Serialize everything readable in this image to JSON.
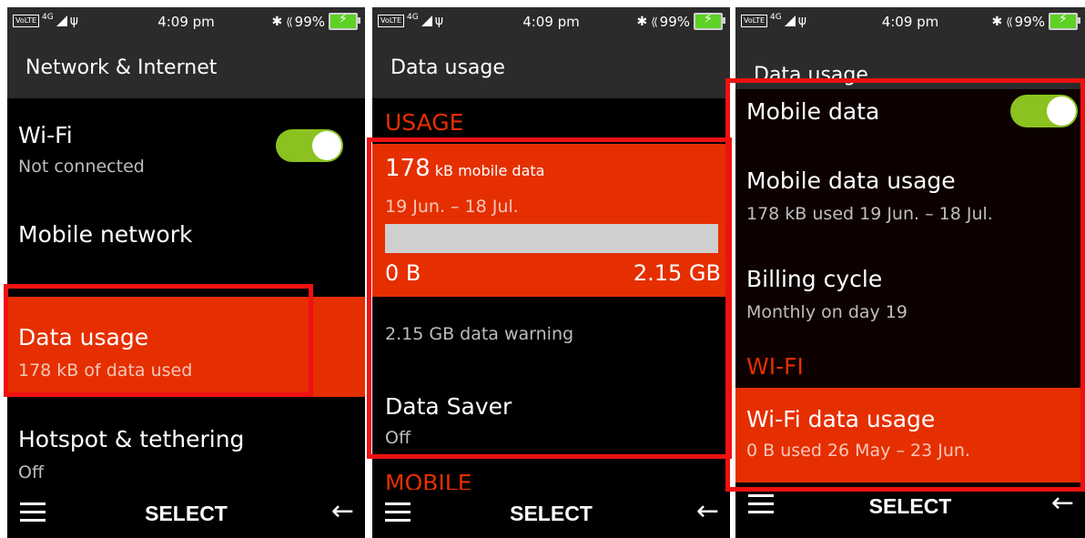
{
  "status": {
    "volte": "VoLTE",
    "network": "4G",
    "time": "4:09 pm",
    "battery": "99%"
  },
  "softkeys": {
    "center": "SELECT"
  },
  "screen1": {
    "title": "Network & Internet",
    "wifi": {
      "label": "Wi-Fi",
      "status": "Not connected",
      "toggle_on": true
    },
    "mobile_network": {
      "label": "Mobile network"
    },
    "data_usage": {
      "label": "Data usage",
      "status": "178 kB of data used"
    },
    "hotspot": {
      "label": "Hotspot & tethering",
      "status": "Off"
    }
  },
  "screen2": {
    "title": "Data usage",
    "section_usage": "USAGE",
    "usage_amount": "178",
    "usage_unit": "kB mobile data",
    "date_range": "19 Jun. – 18 Jul.",
    "bar_fraction": 0.0,
    "bar_min": "0 B",
    "bar_max": "2.15 GB",
    "data_warning": "2.15 GB data warning",
    "data_saver": {
      "label": "Data Saver",
      "status": "Off"
    },
    "section_mobile": "MOBILE"
  },
  "screen3": {
    "title": "Data usage",
    "mobile_data": {
      "label": "Mobile data",
      "toggle_on": true
    },
    "mobile_data_usage": {
      "label": "Mobile data usage",
      "status": "178 kB used 19 Jun. – 18 Jul."
    },
    "billing_cycle": {
      "label": "Billing cycle",
      "status": "Monthly on day 19"
    },
    "section_wifi": "WI-FI",
    "wifi_data_usage": {
      "label": "Wi-Fi data usage",
      "status": "0 B used 26 May – 23 Jun."
    }
  }
}
